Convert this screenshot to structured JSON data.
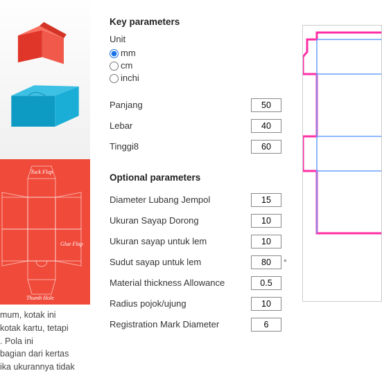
{
  "sections": {
    "key_title": "Key parameters",
    "opt_title": "Optional parameters"
  },
  "unit": {
    "label": "Unit",
    "options": {
      "mm": "mm",
      "cm": "cm",
      "inchi": "inchi"
    }
  },
  "key_params": {
    "panjang": {
      "label": "Panjang",
      "value": "50"
    },
    "lebar": {
      "label": "Lebar",
      "value": "40"
    },
    "tinggi": {
      "label": "Tinggi8",
      "value": "60"
    }
  },
  "opt_params": {
    "dia_jempol": {
      "label": "Diameter Lubang Jempol",
      "value": "15"
    },
    "sayap_dorong": {
      "label": "Ukuran Sayap Dorong",
      "value": "10"
    },
    "sayap_lem": {
      "label": "Ukuran sayap untuk lem",
      "value": "10"
    },
    "sudut_lem": {
      "label": "Sudut sayap untuk lem",
      "value": "80",
      "suffix": "°"
    },
    "mat_thick": {
      "label": "Material thickness Allowance",
      "value": "0.5"
    },
    "radius_pojok": {
      "label": "Radius pojok/ujung",
      "value": "10"
    },
    "reg_mark": {
      "label": "Registration Mark Diameter",
      "value": "6"
    }
  },
  "diagram_labels": {
    "tuck": "Tuck Flap",
    "glue": "Glue Flap",
    "thumb": "Thumb Hole"
  },
  "description": {
    "l1": "mum, kotak ini",
    "l2": "kotak kartu, tetapi",
    "l3": ". Pola ini",
    "l4": "bagian dari kertas",
    "l5": "ika ukurannya tidak"
  }
}
